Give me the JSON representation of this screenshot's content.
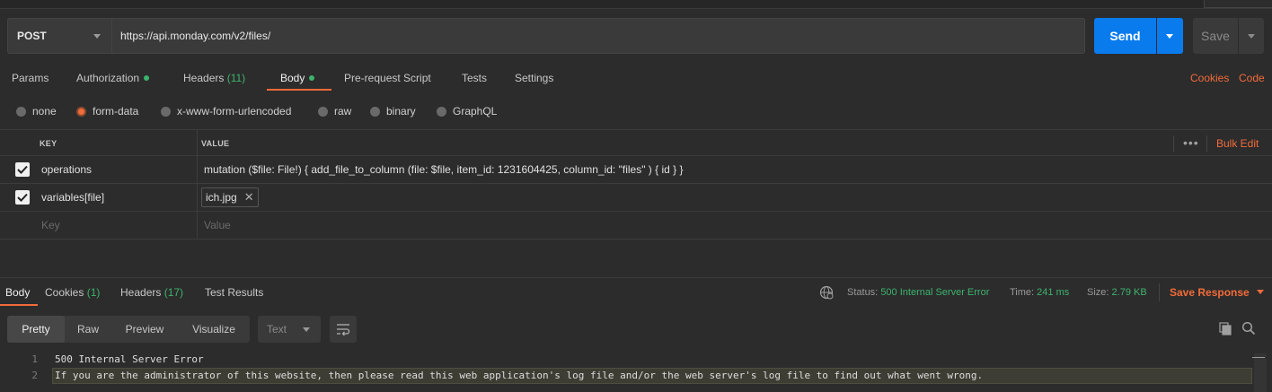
{
  "request": {
    "method": "POST",
    "url": "https://api.monday.com/v2/files/",
    "send_label": "Send",
    "save_label": "Save"
  },
  "request_tabs": {
    "params": "Params",
    "authorization": "Authorization",
    "headers": "Headers",
    "headers_count": "(11)",
    "body": "Body",
    "prerequest": "Pre-request Script",
    "tests": "Tests",
    "settings": "Settings",
    "cookies": "Cookies",
    "code": "Code"
  },
  "body_types": {
    "none": "none",
    "form_data": "form-data",
    "urlencoded": "x-www-form-urlencoded",
    "raw": "raw",
    "binary": "binary",
    "graphql": "GraphQL",
    "selected": "form-data"
  },
  "form_table": {
    "key_header": "KEY",
    "value_header": "VALUE",
    "more": "•••",
    "bulk_edit": "Bulk Edit",
    "rows": [
      {
        "key": "operations",
        "value": "mutation ($file: File!) { add_file_to_column (file: $file, item_id: 1231604425, column_id: \"files\" ) { id } }",
        "checked": true
      },
      {
        "key": "variables[file]",
        "file": "ich.jpg",
        "checked": true
      }
    ],
    "key_placeholder": "Key",
    "value_placeholder": "Value"
  },
  "response_tabs": {
    "body": "Body",
    "cookies": "Cookies",
    "cookies_count": "(1)",
    "headers": "Headers",
    "headers_count": "(17)",
    "test_results": "Test Results"
  },
  "status": {
    "status_label": "Status:",
    "status_value": "500 Internal Server Error",
    "time_label": "Time:",
    "time_value": "241 ms",
    "size_label": "Size:",
    "size_value": "2.79 KB",
    "save_response": "Save Response"
  },
  "view": {
    "pretty": "Pretty",
    "raw": "Raw",
    "preview": "Preview",
    "visualize": "Visualize",
    "format": "Text"
  },
  "response_body": [
    {
      "line": "1",
      "text": "500 Internal Server Error"
    },
    {
      "line": "2",
      "text": "If you are the administrator of this website, then please read this web application's log file and/or the web server's log file to find out what went wrong."
    }
  ],
  "colors": {
    "accent": "#f26b3a",
    "send": "#097bed",
    "success": "#3db36d",
    "background": "#2c2c2c"
  }
}
